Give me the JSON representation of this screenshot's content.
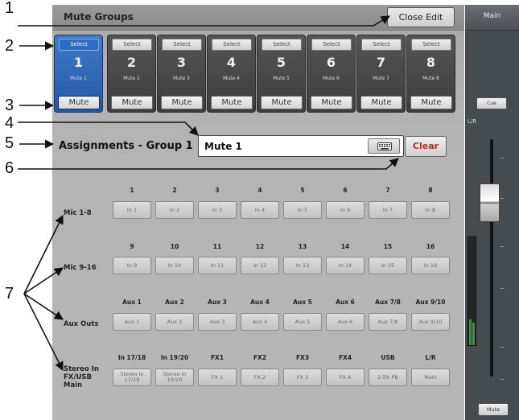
{
  "callouts": [
    "1",
    "2",
    "3",
    "4",
    "5",
    "6",
    "7"
  ],
  "panel": {
    "title": "Mute Groups",
    "close_label": "Close Edit"
  },
  "groups": [
    {
      "select": "Select",
      "number": "1",
      "name": "Mute 1",
      "mute": "Mute",
      "active": true
    },
    {
      "select": "Select",
      "number": "2",
      "name": "Mute 2",
      "mute": "Mute"
    },
    {
      "select": "Select",
      "number": "3",
      "name": "Mute 3",
      "mute": "Mute"
    },
    {
      "select": "Select",
      "number": "4",
      "name": "Mute 4",
      "mute": "Mute"
    },
    {
      "select": "Select",
      "number": "5",
      "name": "Mute 5",
      "mute": "Mute"
    },
    {
      "select": "Select",
      "number": "6",
      "name": "Mute 6",
      "mute": "Mute"
    },
    {
      "select": "Select",
      "number": "7",
      "name": "Mute 7",
      "mute": "Mute"
    },
    {
      "select": "Select",
      "number": "8",
      "name": "Mute 8",
      "mute": "Mute"
    }
  ],
  "assign": {
    "label": "Assignments - Group 1",
    "name_value": "Mute 1",
    "clear_label": "Clear",
    "keyboard_icon": "keyboard-icon"
  },
  "rows": [
    {
      "label": "Mic 1-8",
      "heads": [
        "1",
        "2",
        "3",
        "4",
        "5",
        "6",
        "7",
        "8"
      ],
      "cells": [
        "In 1",
        "In 2",
        "In 3",
        "In 4",
        "In 5",
        "In 6",
        "In 7",
        "In 8"
      ]
    },
    {
      "label": "Mic 9-16",
      "heads": [
        "9",
        "10",
        "11",
        "12",
        "13",
        "14",
        "15",
        "16"
      ],
      "cells": [
        "In 9",
        "In 10",
        "In 11",
        "In 12",
        "In 13",
        "In 14",
        "In 15",
        "In 16"
      ]
    },
    {
      "label": "Aux Outs",
      "heads": [
        "Aux 1",
        "Aux 2",
        "Aux 3",
        "Aux 4",
        "Aux 5",
        "Aux 6",
        "Aux 7/8",
        "Aux 9/10"
      ],
      "cells": [
        "Aux 1",
        "Aux 2",
        "Aux 3",
        "Aux 4",
        "Aux 5",
        "Aux 6",
        "Aux 7/8",
        "Aux 9/10"
      ]
    },
    {
      "label": "Stereo In FX/USB Main",
      "heads": [
        "In 17/18",
        "In 19/20",
        "FX1",
        "FX2",
        "FX3",
        "FX4",
        "USB",
        "L/R"
      ],
      "cells": [
        "Stereo In 17/18",
        "Stereo In 19/20",
        "FX 1",
        "FX 2",
        "FX 3",
        "FX 4",
        "2-Trk PB",
        "Main"
      ]
    }
  ],
  "strip": {
    "title": "Main",
    "cue": "Cue",
    "channel": "L/R",
    "mute": "Mute"
  },
  "colors": {
    "active_group": "#2a62b2",
    "clear_text": "#c0261f",
    "meter_green": "#2e9a3f"
  }
}
